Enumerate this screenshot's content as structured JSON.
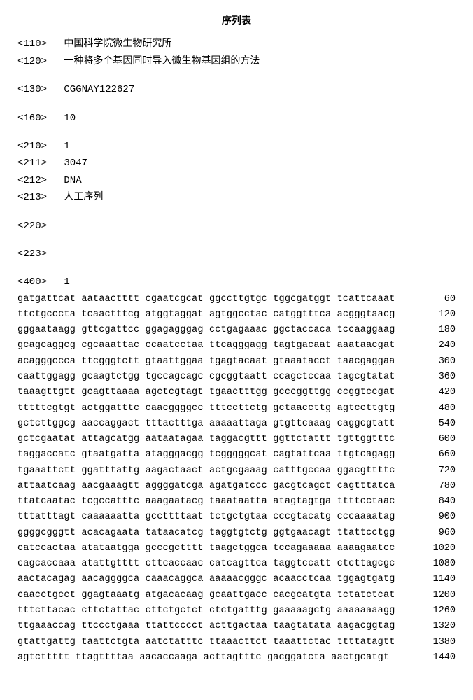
{
  "title": "序列表",
  "headers": {
    "110": {
      "tag": "<110>",
      "value": "中国科学院微生物研究所"
    },
    "120": {
      "tag": "<120>",
      "value": "一种将多个基因同时导入微生物基因组的方法"
    },
    "130": {
      "tag": "<130>",
      "value": "CGGNAY122627"
    },
    "160": {
      "tag": "<160>",
      "value": "10"
    },
    "210": {
      "tag": "<210>",
      "value": "1"
    },
    "211": {
      "tag": "<211>",
      "value": "3047"
    },
    "212": {
      "tag": "<212>",
      "value": "DNA"
    },
    "213": {
      "tag": "<213>",
      "value": "人工序列"
    },
    "220": {
      "tag": "<220>",
      "value": ""
    },
    "223": {
      "tag": "<223>",
      "value": ""
    },
    "400": {
      "tag": "<400>",
      "value": "1"
    }
  },
  "sequence": [
    {
      "seq": "gatgattcat aataactttt cgaatcgcat ggccttgtgc tggcgatggt tcattcaaat",
      "pos": "60"
    },
    {
      "seq": "ttctgcccta tcaactttcg atggtaggat agtggcctac catggtttca acgggtaacg",
      "pos": "120"
    },
    {
      "seq": "gggaataagg gttcgattcc ggagagggag cctgagaaac ggctaccaca tccaaggaag",
      "pos": "180"
    },
    {
      "seq": "gcagcaggcg cgcaaattac ccaatcctaa ttcagggagg tagtgacaat aaataacgat",
      "pos": "240"
    },
    {
      "seq": "acagggccca ttcgggtctt gtaattggaa tgagtacaat gtaaatacct taacgaggaa",
      "pos": "300"
    },
    {
      "seq": "caattggagg gcaagtctgg tgccagcagc cgcggtaatt ccagctccaa tagcgtatat",
      "pos": "360"
    },
    {
      "seq": "taaagttgtt gcagttaaaa agctcgtagt tgaactttgg gcccggttgg ccggtccgat",
      "pos": "420"
    },
    {
      "seq": "tttttcgtgt actggatttc caacggggcc tttccttctg gctaaccttg agtccttgtg",
      "pos": "480"
    },
    {
      "seq": "gctcttggcg aaccaggact tttactttga aaaaattaga gtgttcaaag caggcgtatt",
      "pos": "540"
    },
    {
      "seq": "gctcgaatat attagcatgg aataatagaa taggacgttt ggttctattt tgttggtttc",
      "pos": "600"
    },
    {
      "seq": "taggaccatc gtaatgatta atagggacgg tcgggggcat cagtattcaa ttgtcagagg",
      "pos": "660"
    },
    {
      "seq": "tgaaattctt ggatttattg aagactaact actgcgaaag catttgccaa ggacgttttc",
      "pos": "720"
    },
    {
      "seq": "attaatcaag aacgaaagtt aggggatcga agatgatccc gacgtcagct cagtttatca",
      "pos": "780"
    },
    {
      "seq": "ttatcaatac tcgccatttc aaagaatacg taaataatta atagtagtga ttttcctaac",
      "pos": "840"
    },
    {
      "seq": "tttatttagt caaaaaatta gccttttaat tctgctgtaa cccgtacatg cccaaaatag",
      "pos": "900"
    },
    {
      "seq": "ggggcgggtt acacagaata tataacatcg taggtgtctg ggtgaacagt ttattcctgg",
      "pos": "960"
    },
    {
      "seq": "catccactaa atataatgga gcccgctttt taagctggca tccagaaaaa aaaagaatcc",
      "pos": "1020"
    },
    {
      "seq": "cagcaccaaa atattgtttt cttcaccaac catcagttca taggtccatt ctcttagcgc",
      "pos": "1080"
    },
    {
      "seq": "aactacagag aacaggggca caaacaggca aaaaacgggc acaacctcaa tggagtgatg",
      "pos": "1140"
    },
    {
      "seq": "caacctgcct ggagtaaatg atgacacaag gcaattgacc cacgcatgta tctatctcat",
      "pos": "1200"
    },
    {
      "seq": "tttcttacac cttctattac cttctgctct ctctgatttg gaaaaagctg aaaaaaaagg",
      "pos": "1260"
    },
    {
      "seq": "ttgaaaccag ttccctgaaa ttattcccct acttgactaa taagtatata aagacggtag",
      "pos": "1320"
    },
    {
      "seq": "gtattgattg taattctgta aatctatttc ttaaacttct taaattctac ttttatagtt",
      "pos": "1380"
    },
    {
      "seq": "agtcttttt ttagttttaa aacaccaaga acttagtttc gacggatcta aactgcatgt",
      "pos": "1440"
    }
  ]
}
